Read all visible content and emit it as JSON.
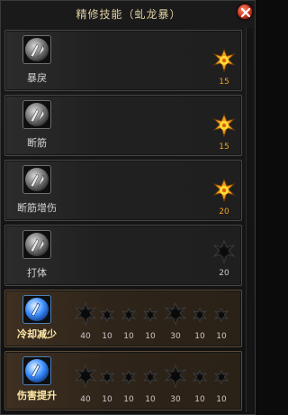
{
  "window": {
    "title": "精修技能（虬龙暴）"
  },
  "icons": {
    "close": "close-icon",
    "skill": "blade-skill-icon",
    "star": "star-gem-icon"
  },
  "colors": {
    "gold_star": "#f0a020",
    "dark_star": "#1a1a1a",
    "brown_row": "#3e3022"
  },
  "skills": [
    {
      "name": "暴戾",
      "value": "15",
      "active": true
    },
    {
      "name": "断筋",
      "value": "15",
      "active": true
    },
    {
      "name": "断筋增伤",
      "value": "20",
      "active": true
    },
    {
      "name": "打体",
      "value": "20",
      "active": false
    }
  ],
  "rune_skills": [
    {
      "name": "冷却减少",
      "values": [
        "40",
        "10",
        "10",
        "10",
        "30",
        "10",
        "10"
      ]
    },
    {
      "name": "伤害提升",
      "values": [
        "40",
        "10",
        "10",
        "10",
        "30",
        "10",
        "10"
      ]
    }
  ]
}
